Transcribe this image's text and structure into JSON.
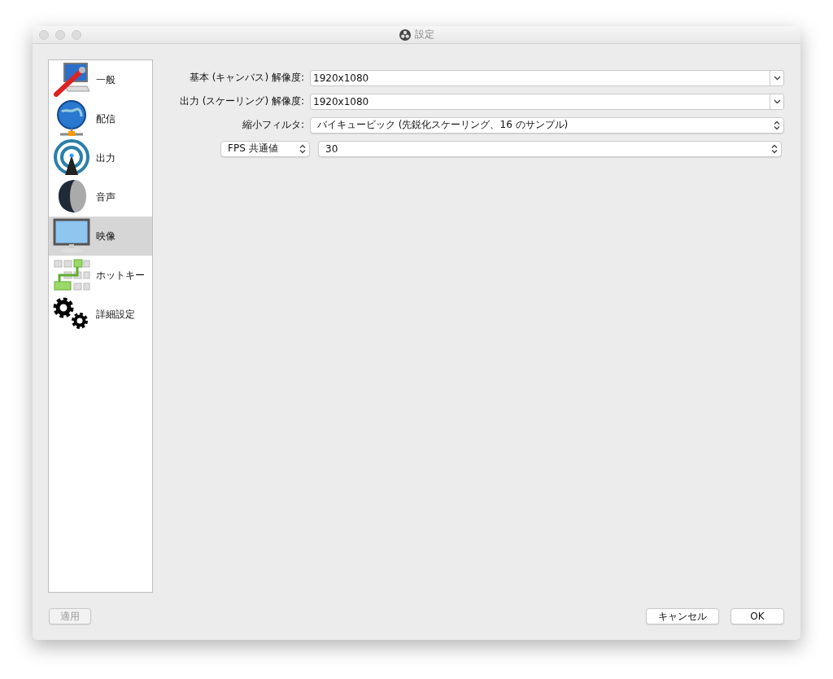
{
  "window": {
    "title": "設定"
  },
  "sidebar": {
    "items": [
      {
        "label": "一般",
        "selected": false
      },
      {
        "label": "配信",
        "selected": false
      },
      {
        "label": "出力",
        "selected": false
      },
      {
        "label": "音声",
        "selected": false
      },
      {
        "label": "映像",
        "selected": true
      },
      {
        "label": "ホットキー",
        "selected": false
      },
      {
        "label": "詳細設定",
        "selected": false
      }
    ]
  },
  "form": {
    "rows": [
      {
        "kind": "combo",
        "label": "基本 (キャンバス) 解像度:",
        "value": "1920x1080"
      },
      {
        "kind": "combo",
        "label": "出力 (スケーリング) 解像度:",
        "value": "1920x1080"
      },
      {
        "kind": "select",
        "label": "縮小フィルタ:",
        "value": "バイキュービック (先鋭化スケーリング、16 のサンプル)"
      },
      {
        "kind": "select-label",
        "label": "FPS 共通値",
        "value": "30"
      }
    ]
  },
  "buttons": [
    {
      "label": "適用",
      "disabled": true
    },
    {
      "label": "キャンセル",
      "disabled": false
    },
    {
      "label": "OK",
      "disabled": false
    }
  ]
}
